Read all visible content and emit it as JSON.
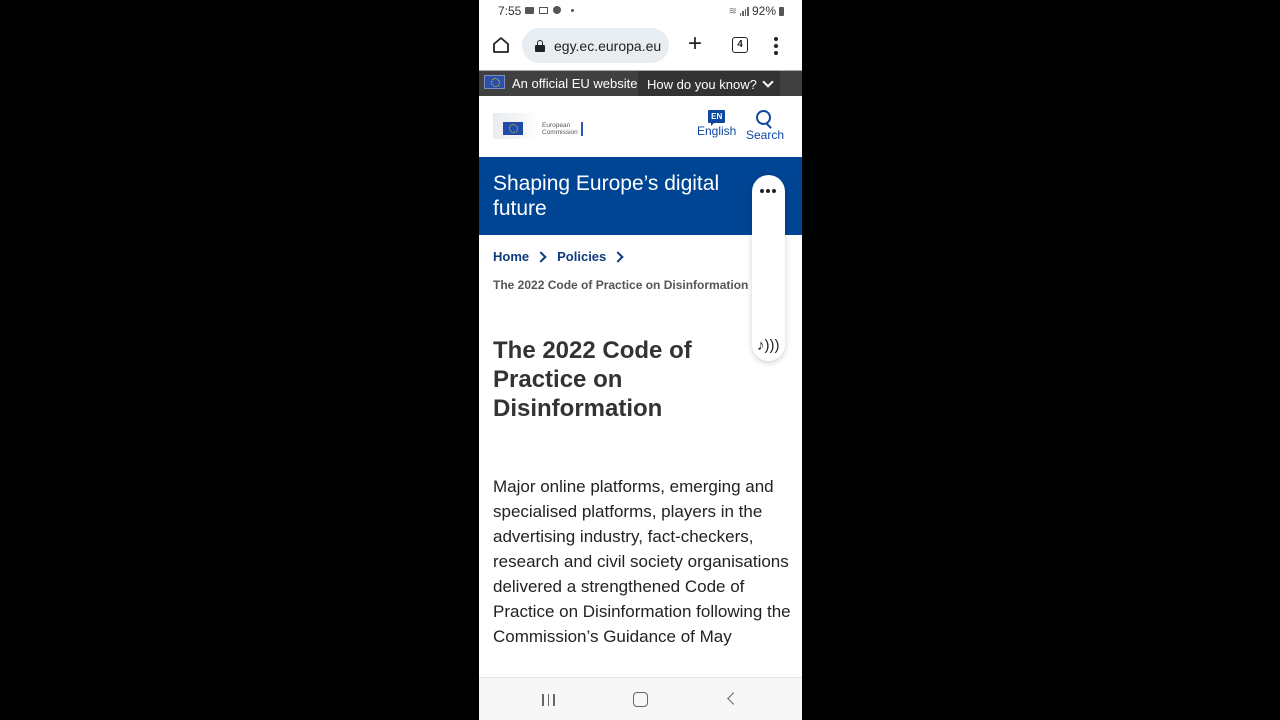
{
  "status_bar": {
    "time": "7:55",
    "notification_icons": [
      "youtube-icon",
      "gmail-icon",
      "app-icon",
      "more-dot-icon"
    ],
    "battery": "92%"
  },
  "browser": {
    "url": "egy.ec.europa.eu",
    "tab_count": "4"
  },
  "eu_banner": {
    "official_text": "An official EU website",
    "how_text": "How do you know?"
  },
  "header": {
    "logo_line1": "European",
    "logo_line2": "Commission",
    "lang_code": "EN",
    "lang_label": "English",
    "search_label": "Search"
  },
  "site_banner": {
    "title": "Shaping Europe’s digital future"
  },
  "breadcrumb": {
    "items": [
      "Home",
      "Policies"
    ],
    "current": "The 2022 Code of Practice on Disinformation"
  },
  "page": {
    "title": "The 2022 Code of Practice on Disinformation",
    "paragraph": "Major online platforms, emerging and specialised platforms, players in the advertising industry, fact-checkers, research and civil society organisations delivered a strengthened Code of Practice on Disinformation following the Commission’s Guidance of May"
  },
  "colors": {
    "brand_blue": "#004494",
    "link_blue": "#0e3a7e",
    "eu_bar": "#404040"
  }
}
